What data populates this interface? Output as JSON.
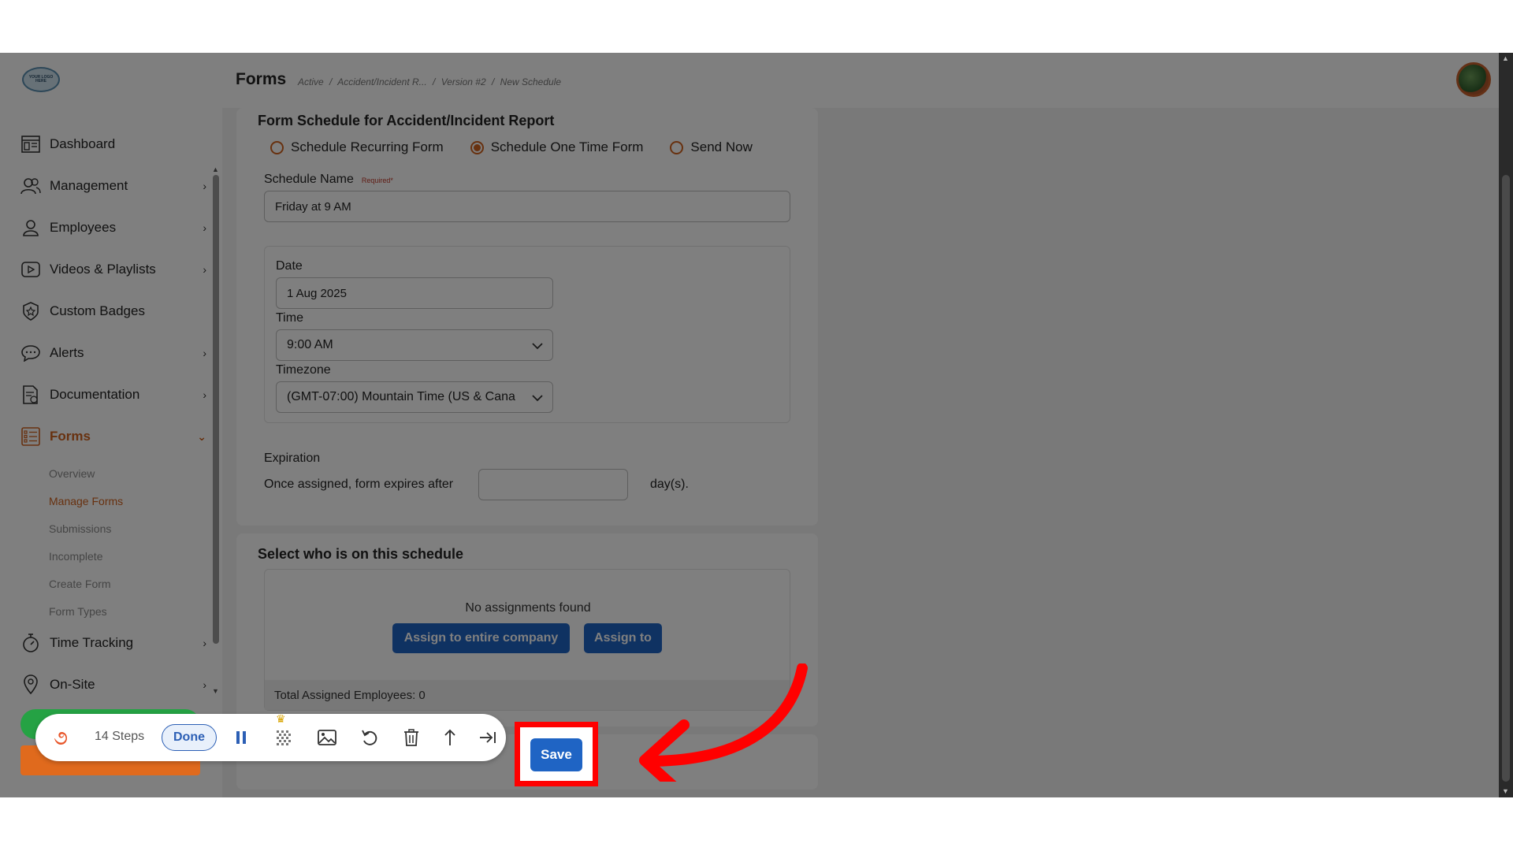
{
  "header": {
    "logo_text": "YOUR LOGO HERE",
    "title": "Forms",
    "breadcrumb": [
      "Active",
      "/",
      "Accident/Incident R...",
      "/",
      "Version #2",
      "/",
      "New Schedule"
    ]
  },
  "sidebar": {
    "items": [
      {
        "label": "Dashboard",
        "icon": "dashboard-icon",
        "has_chevron": false
      },
      {
        "label": "Management",
        "icon": "users-icon",
        "has_chevron": true
      },
      {
        "label": "Employees",
        "icon": "user-icon",
        "has_chevron": true
      },
      {
        "label": "Videos & Playlists",
        "icon": "play-icon",
        "has_chevron": true
      },
      {
        "label": "Custom Badges",
        "icon": "badge-icon",
        "has_chevron": false
      },
      {
        "label": "Alerts",
        "icon": "chat-icon",
        "has_chevron": true
      },
      {
        "label": "Documentation",
        "icon": "document-icon",
        "has_chevron": true
      },
      {
        "label": "Forms",
        "icon": "list-icon",
        "has_chevron": true
      },
      {
        "label": "Time Tracking",
        "icon": "stopwatch-icon",
        "has_chevron": true
      },
      {
        "label": "On-Site",
        "icon": "location-pin-icon",
        "has_chevron": true
      }
    ],
    "forms_subitems": [
      "Overview",
      "Manage Forms",
      "Submissions",
      "Incomplete",
      "Create Form",
      "Form Types"
    ],
    "active_item": "Forms",
    "active_subitem": "Manage Forms"
  },
  "schedule_form": {
    "title": "Form Schedule for Accident/Incident Report",
    "radio_options": [
      "Schedule Recurring Form",
      "Schedule One Time Form",
      "Send Now"
    ],
    "selected_option": "Schedule One Time Form",
    "name_label": "Schedule Name",
    "required_text": "Required*",
    "name_value": "Friday at 9 AM",
    "date_label": "Date",
    "date_value": "1 Aug 2025",
    "time_label": "Time",
    "time_value": "9:00 AM",
    "timezone_label": "Timezone",
    "timezone_value": "(GMT-07:00) Mountain Time (US & Cana",
    "expiration_label": "Expiration",
    "expiration_prefix": "Once assigned, form expires after",
    "expiration_value": "",
    "expiration_suffix": "day(s)."
  },
  "assignment": {
    "title": "Select who is on this schedule",
    "empty_text": "No assignments found",
    "assign_company_label": "Assign to entire company",
    "assign_to_label": "Assign to",
    "total_text": "Total Assigned Employees: 0"
  },
  "recorder": {
    "steps_text": "14 Steps",
    "done_label": "Done"
  },
  "save_label": "Save",
  "colors": {
    "accent_orange": "#d0621f",
    "primary_blue": "#1f64c4",
    "highlight_red": "#ff0000"
  }
}
